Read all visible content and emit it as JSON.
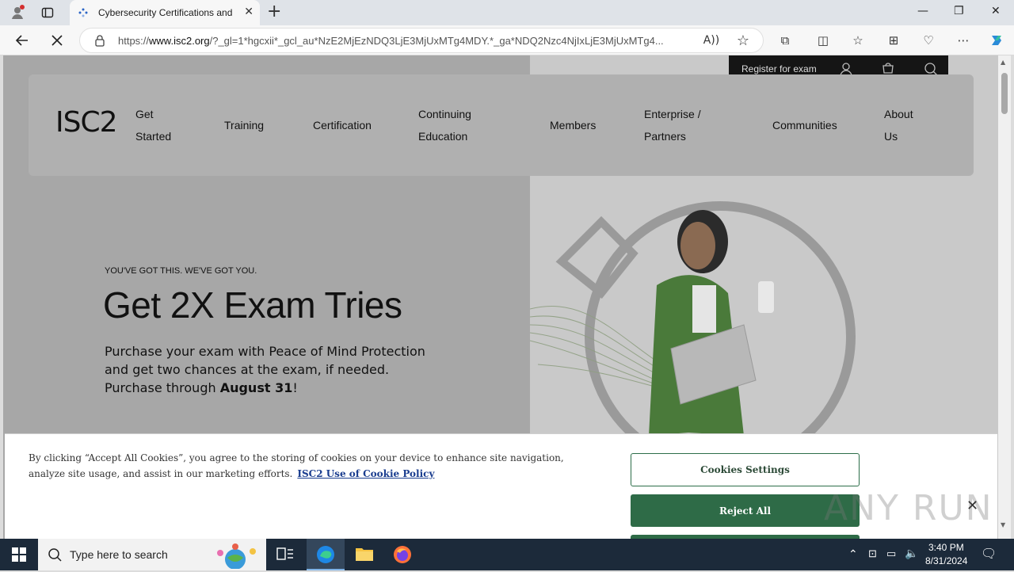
{
  "browser": {
    "tab_title": "Cybersecurity Certifications and",
    "url_prefix": "https://",
    "url_host": "www.isc2.org",
    "url_rest": "/?_gl=1*hgcxii*_gcl_au*NzE2MjEzNDQ3LjE3MjUxMTg4MDY.*_ga*NDQ2Nzc4NjIxLjE3MjUxMTg4..."
  },
  "site": {
    "utility": {
      "register_label": "Register for exam"
    },
    "logo_text": "ISC2",
    "nav": [
      {
        "line1": "Get",
        "line2": "Started"
      },
      {
        "line1": "Training",
        "line2": ""
      },
      {
        "line1": "Certification",
        "line2": ""
      },
      {
        "line1": "Continuing",
        "line2": "Education"
      },
      {
        "line1": "Members",
        "line2": ""
      },
      {
        "line1": "Enterprise /",
        "line2": "Partners"
      },
      {
        "line1": "Communities",
        "line2": ""
      },
      {
        "line1": "About",
        "line2": "Us"
      }
    ],
    "hero": {
      "eyebrow": "YOU'VE GOT THIS. WE'VE GOT YOU.",
      "headline": "Get 2X Exam Tries",
      "body": "Purchase your exam with Peace of Mind Protection and get two chances at the exam, if needed. Purchase through ",
      "body_bold": "August 31",
      "body_end": "!"
    }
  },
  "cookie_banner": {
    "text": "By clicking “Accept All Cookies”, you agree to the storing of cookies on your device to enhance site navigation, analyze site usage, and assist in our marketing efforts.",
    "policy_link": "ISC2 Use of Cookie Policy",
    "settings_label": "Cookies Settings",
    "reject_label": "Reject All"
  },
  "watermark": "ANY RUN",
  "taskbar": {
    "search_placeholder": "Type here to search",
    "time": "3:40 PM",
    "date": "8/31/2024"
  },
  "colors": {
    "accent_green": "#2e6b47",
    "utility_bar": "#151515"
  }
}
